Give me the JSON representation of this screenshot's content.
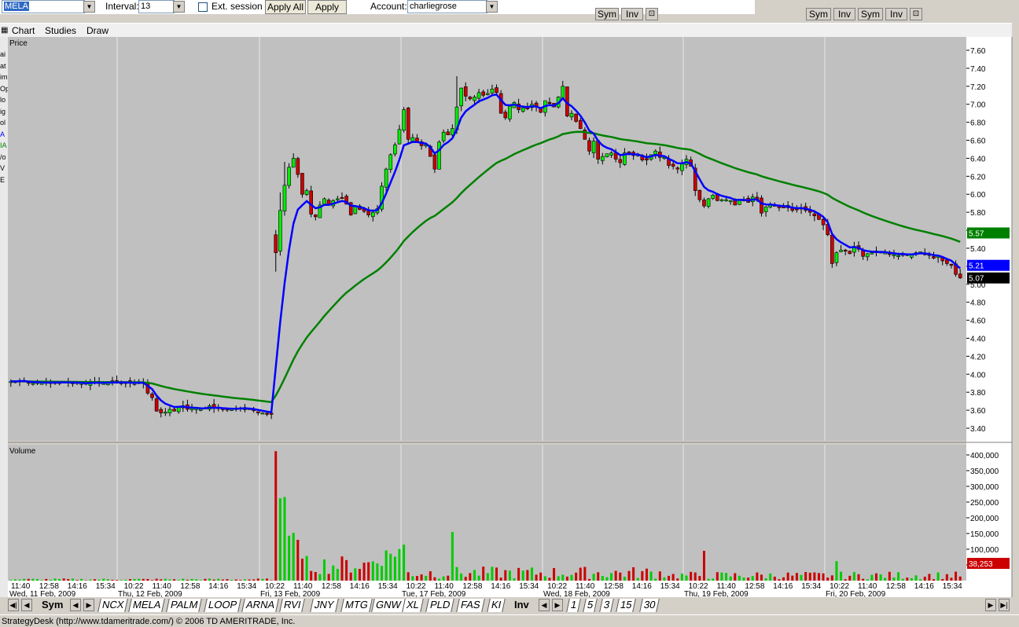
{
  "toolbar": {
    "symbol_value": "MELA",
    "interval_label": "Interval:",
    "interval_value": "13",
    "ext_session_label": "Ext. session",
    "apply_all_label": "Apply All",
    "apply_label": "Apply",
    "account_label": "Account:",
    "account_value": "charliegrose"
  },
  "sym_buttons": {
    "sym": "Sym",
    "inv": "Inv"
  },
  "menu": {
    "chart": "Chart",
    "studies": "Studies",
    "draw": "Draw"
  },
  "left_strip_chars": [
    "ai",
    "at",
    "im",
    "Op",
    "lo",
    "ig",
    "ol",
    "A",
    "IA",
    "/o",
    "V",
    "E"
  ],
  "price_panel": {
    "title": "Price",
    "y_ticks": [
      "7.60",
      "7.40",
      "7.20",
      "7.00",
      "6.80",
      "6.60",
      "6.40",
      "6.20",
      "6.00",
      "5.80",
      "5.60",
      "5.40",
      "5.20",
      "5.00",
      "4.80",
      "4.60",
      "4.40",
      "4.20",
      "4.00",
      "3.80",
      "3.60",
      "3.40"
    ],
    "tags": {
      "ma_slow": "5.57",
      "ma_fast": "5.21",
      "last": "5.07"
    }
  },
  "volume_panel": {
    "title": "Volume",
    "y_ticks": [
      "400,000",
      "350,000",
      "300,000",
      "250,000",
      "200,000",
      "150,000",
      "100,000",
      "50,000"
    ],
    "last_volume": "38,253"
  },
  "time_axis": {
    "times": [
      "11:40",
      "12:58",
      "14:16",
      "15:34",
      "10:22",
      "11:40",
      "12:58",
      "14:16",
      "15:34",
      "10:22",
      "11:40",
      "12:58",
      "14:16",
      "15:34",
      "10:22",
      "11:40",
      "12:58",
      "14:16",
      "15:34",
      "10:22",
      "11:40",
      "12:58",
      "14:16",
      "15:34",
      "10:22",
      "11:40",
      "12:58",
      "14:16",
      "15:34",
      "10:22",
      "11:40",
      "12:58",
      "14:16",
      "15:34"
    ],
    "dates": [
      "Wed, 11 Feb, 2009",
      "Thu, 12 Feb, 2009",
      "Fri, 13 Feb, 2009",
      "Tue, 17 Feb, 2009",
      "Wed, 18 Feb, 2009",
      "Thu, 19 Feb, 2009",
      "Fri, 20 Feb, 2009"
    ]
  },
  "chart_data": {
    "type": "candlestick",
    "sessions": [
      "Wed, 11 Feb, 2009",
      "Thu, 12 Feb, 2009",
      "Fri, 13 Feb, 2009",
      "Tue, 17 Feb, 2009",
      "Wed, 18 Feb, 2009",
      "Thu, 19 Feb, 2009",
      "Fri, 20 Feb, 2009"
    ],
    "bars_per_session": 30,
    "close": [
      3.92,
      3.92,
      3.93,
      3.93,
      3.9,
      3.9,
      3.91,
      3.9,
      3.9,
      3.91,
      3.91,
      3.91,
      3.91,
      3.91,
      3.91,
      3.9,
      3.9,
      3.89,
      3.91,
      3.91,
      3.91,
      3.9,
      3.91,
      3.91,
      3.91,
      3.91,
      3.91,
      3.9,
      3.9,
      3.91,
      3.9,
      3.79,
      3.74,
      3.59,
      3.57,
      3.58,
      3.61,
      3.59,
      3.64,
      3.65,
      3.61,
      3.62,
      3.62,
      3.61,
      3.62,
      3.65,
      3.62,
      3.63,
      3.61,
      3.61,
      3.61,
      3.62,
      3.62,
      3.63,
      3.61,
      3.6,
      3.58,
      3.57,
      3.56,
      3.56,
      5.35,
      5.82,
      6.1,
      6.3,
      6.4,
      6.22,
      6.0,
      6.04,
      5.78,
      5.75,
      5.88,
      5.95,
      5.88,
      5.93,
      5.95,
      5.96,
      5.89,
      5.77,
      5.86,
      5.83,
      5.81,
      5.77,
      5.8,
      5.84,
      6.09,
      6.28,
      6.44,
      6.55,
      6.72,
      6.94,
      6.61,
      6.63,
      6.58,
      6.54,
      6.55,
      6.42,
      6.28,
      6.58,
      6.69,
      6.66,
      6.73,
      6.97,
      7.18,
      7.09,
      7.06,
      7.08,
      7.13,
      7.1,
      7.12,
      7.17,
      7.13,
      6.9,
      6.85,
      6.98,
      7.02,
      6.94,
      6.96,
      6.95,
      7.0,
      6.97,
      6.91,
      7.04,
      7.02,
      6.97,
      7.08,
      7.2,
      6.87,
      6.9,
      6.81,
      6.73,
      6.61,
      6.48,
      6.59,
      6.39,
      6.42,
      6.45,
      6.46,
      6.39,
      6.35,
      6.46,
      6.47,
      6.43,
      6.44,
      6.38,
      6.38,
      6.44,
      6.48,
      6.41,
      6.41,
      6.32,
      6.31,
      6.28,
      6.34,
      6.39,
      6.31,
      6.04,
      5.94,
      5.87,
      5.95,
      5.99,
      5.93,
      5.94,
      5.94,
      5.93,
      5.88,
      5.94,
      5.94,
      5.91,
      5.97,
      5.94,
      5.79,
      5.86,
      5.88,
      5.87,
      5.85,
      5.86,
      5.85,
      5.82,
      5.83,
      5.85,
      5.82,
      5.8,
      5.76,
      5.72,
      5.66,
      5.55,
      5.23,
      5.35,
      5.38,
      5.37,
      5.34,
      5.42,
      5.39,
      5.31,
      5.34,
      5.35,
      5.35,
      5.36,
      5.35,
      5.33,
      5.33,
      5.32,
      5.34,
      5.32,
      5.33,
      5.35,
      5.36,
      5.34,
      5.32,
      5.29,
      5.31,
      5.26,
      5.23,
      5.21,
      5.11,
      5.07
    ],
    "ma_fast": {
      "color": "#0000ff"
    },
    "ma_slow": {
      "color": "#008000"
    },
    "volume": {
      "spike_index": 60,
      "spike_value": 412000
    },
    "ylim": [
      3.3,
      7.7
    ]
  }
}
